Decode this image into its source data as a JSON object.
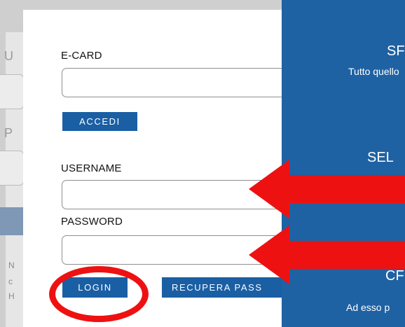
{
  "form": {
    "ecard_label": "E-CARD",
    "ecard_value": "",
    "accedi_button": "ACCEDI",
    "username_label": "USERNAME",
    "username_value": "",
    "password_label": "PASSWORD",
    "password_value": "",
    "login_button": "LOGIN",
    "recover_button": "RECUPERA PASS"
  },
  "side_panel": {
    "line1": "SF",
    "line2": "Tutto quello",
    "line3": "SEL",
    "line4": "CF",
    "line5": "Ad esso p"
  },
  "background": {
    "chars": [
      "U",
      "P",
      "N",
      "c",
      "H"
    ]
  },
  "colors": {
    "accent_blue": "#1a5fa4",
    "panel_blue": "#1f62a3",
    "annotation_red": "#ee1111"
  },
  "icons": {
    "arrow": "left-arrow",
    "highlight": "circle"
  }
}
